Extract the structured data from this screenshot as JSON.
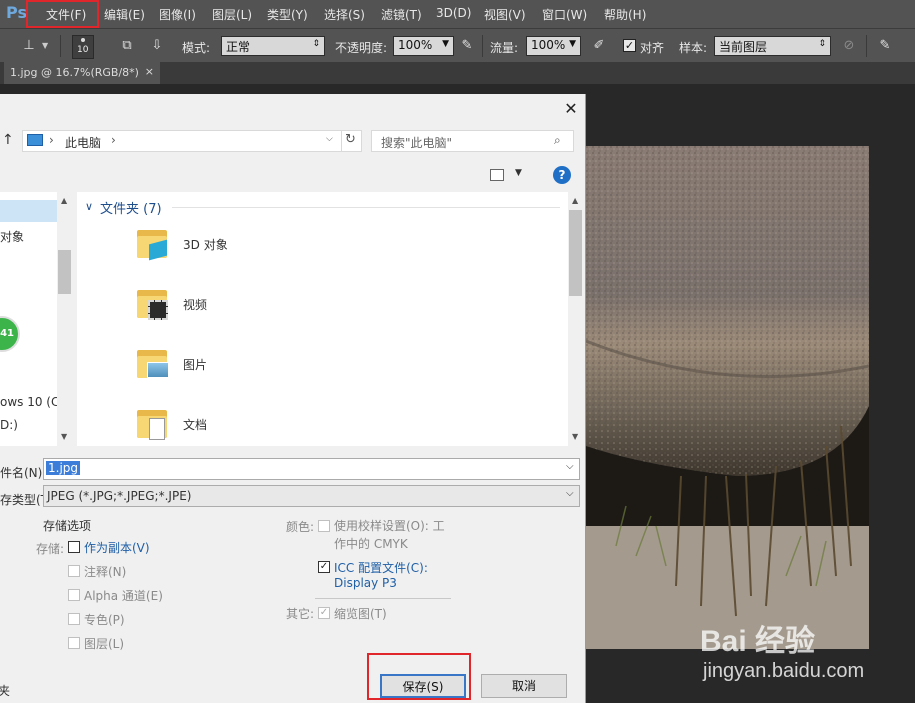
{
  "app": {
    "logo": "Ps"
  },
  "menu": [
    "文件(F)",
    "编辑(E)",
    "图像(I)",
    "图层(L)",
    "类型(Y)",
    "选择(S)",
    "滤镜(T)",
    "3D(D)",
    "视图(V)",
    "窗口(W)",
    "帮助(H)"
  ],
  "options": {
    "brush_size": "10",
    "mode_label": "模式:",
    "mode_value": "正常",
    "opacity_label": "不透明度:",
    "opacity_value": "100%",
    "flow_label": "流量:",
    "flow_value": "100%",
    "align_label": "对齐",
    "sample_label": "样本:",
    "sample_value": "当前图层"
  },
  "document_tab": {
    "title": "1.jpg @ 16.7%(RGB/8*)",
    "close": "×"
  },
  "dialog": {
    "close": "✕",
    "breadcrumb": "此电脑",
    "search_placeholder": "搜索\"此电脑\"",
    "help": "?",
    "tree": {
      "item1": "对象",
      "item2": "41",
      "item3": "ows 10 (C",
      "item4": "D:)"
    },
    "group_header": "文件夹 (7)",
    "folders": [
      "3D 对象",
      "视频",
      "图片",
      "文档"
    ],
    "filename_label": "文件名(N):",
    "filename_value": "1.jpg",
    "filetype_label": "保存类型(T):",
    "filetype_value": "JPEG (*.JPG;*.JPEG;*.JPE)",
    "save_options": {
      "title": "存储选项",
      "store_label": "存储:",
      "as_copy": "作为副本(V)",
      "notes": "注释(N)",
      "alpha": "Alpha 通道(E)",
      "spot": "专色(P)",
      "layers": "图层(L)"
    },
    "color": {
      "label": "颜色:",
      "proof_line1": "使用校样设置(O): 工",
      "proof_line2": "作中的 CMYK",
      "icc_line1": "ICC 配置文件(C):",
      "icc_line2": "Display P3"
    },
    "other": {
      "label": "其它:",
      "thumbnail": "缩览图(T)"
    },
    "hide_folders": "夹",
    "save_button": "保存(S)",
    "cancel_button": "取消"
  },
  "watermark": {
    "logo": "Bai 经验",
    "url": "jingyan.baidu.com"
  }
}
